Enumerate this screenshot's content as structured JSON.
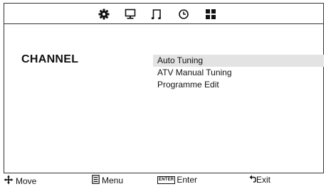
{
  "top_tabs": [
    {
      "icon": "gear-icon"
    },
    {
      "icon": "monitor-icon"
    },
    {
      "icon": "music-note-icon"
    },
    {
      "icon": "clock-icon"
    },
    {
      "icon": "grid-icon"
    }
  ],
  "category_title": "CHANNEL",
  "menu": {
    "items": [
      {
        "label": "Auto Tuning",
        "selected": true
      },
      {
        "label": "ATV Manual Tuning",
        "selected": false
      },
      {
        "label": "Programme Edit",
        "selected": false
      }
    ]
  },
  "footer": {
    "move_label": "Move",
    "menu_label": "Menu",
    "enter_key": "ENTER",
    "enter_label": "Enter",
    "exit_label": "Exit"
  },
  "colors": {
    "selected_background": "#e3e3e3",
    "border": "#333333"
  }
}
